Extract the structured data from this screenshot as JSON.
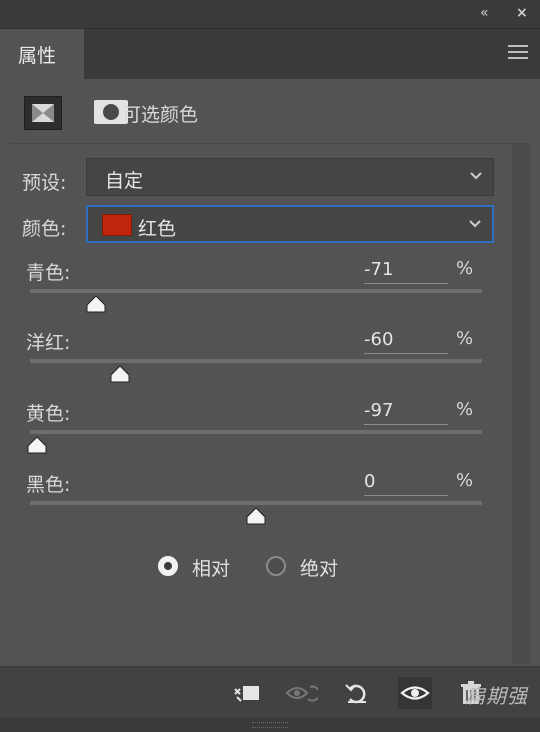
{
  "window": {
    "collapse_glyph": "«",
    "close_glyph": "×"
  },
  "tab": {
    "title": "属性"
  },
  "header": {
    "adjustment_title": "可选颜色",
    "icons": [
      "selective-color-adjustment-icon",
      "layer-mask-icon"
    ]
  },
  "preset": {
    "label": "预设:",
    "value": "自定"
  },
  "colors": {
    "label": "颜色:",
    "value": "红色",
    "swatch_color": "#c0260c"
  },
  "sliders": [
    {
      "label": "青色:",
      "value": "-71",
      "unit": "%",
      "numeric": -71
    },
    {
      "label": "洋红:",
      "value": "-60",
      "unit": "%",
      "numeric": -60
    },
    {
      "label": "黄色:",
      "value": "-97",
      "unit": "%",
      "numeric": -97
    },
    {
      "label": "黑色:",
      "value": "0",
      "unit": "%",
      "numeric": 0
    }
  ],
  "method": {
    "options": [
      {
        "label": "相对",
        "selected": true
      },
      {
        "label": "绝对",
        "selected": false
      }
    ]
  },
  "footer": {
    "icons": [
      "clip-to-layer-icon",
      "view-previous-state-icon",
      "reset-icon",
      "visibility-eye-icon",
      "delete-trash-icon"
    ]
  },
  "watermark": "扁期强",
  "theme": {
    "panel": "#535353",
    "chrome": "#3a3a3a",
    "accent_focus": "#2f6fbf"
  }
}
